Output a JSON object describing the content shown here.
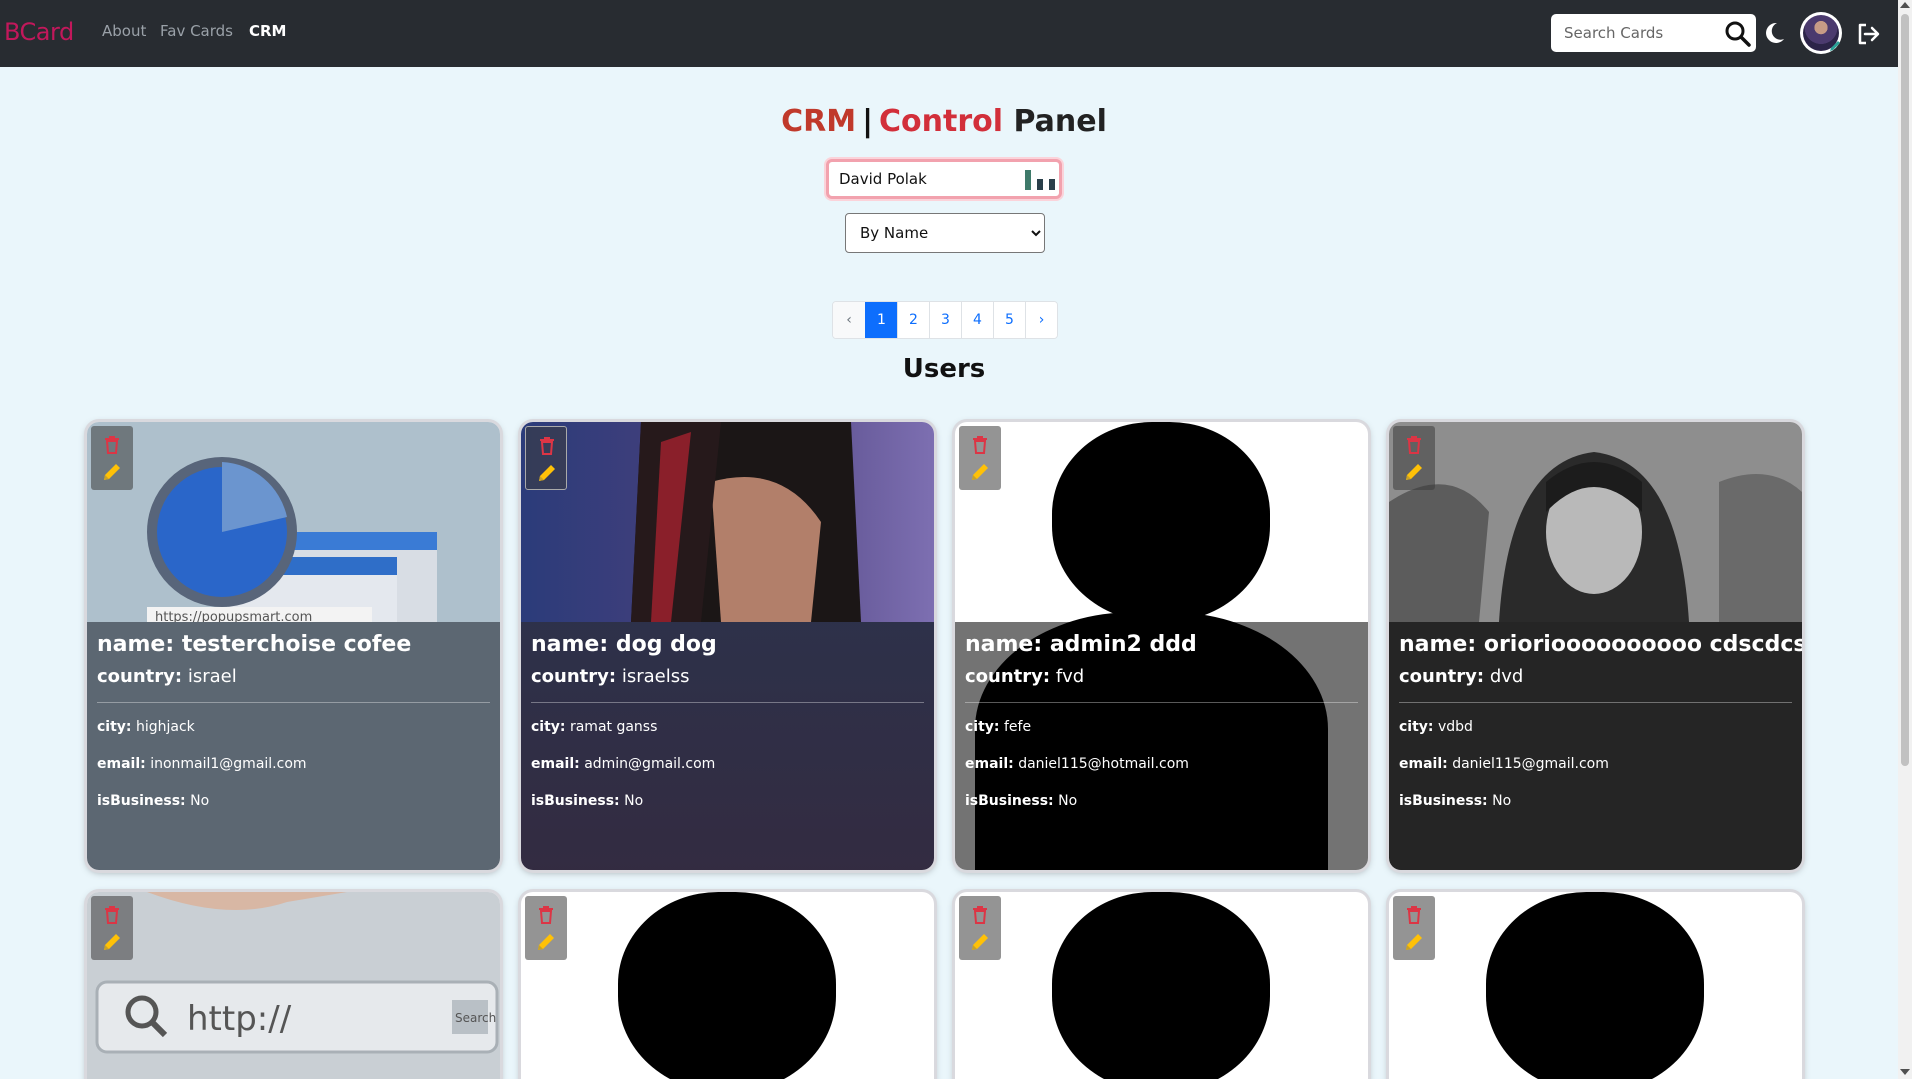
{
  "navbar": {
    "brand": "BCard",
    "links": [
      {
        "label": "About",
        "active": false
      },
      {
        "label": "Fav Cards",
        "active": false
      },
      {
        "label": "CRM",
        "active": true
      }
    ],
    "search_placeholder": "Search Cards",
    "icons": [
      "search-icon",
      "moon-icon",
      "avatar",
      "pencil-icon",
      "logout-icon"
    ]
  },
  "heading": {
    "crm": "CRM",
    "separator": "|",
    "control": "Control",
    "panel": "Panel"
  },
  "crm_search": {
    "value": "David Polak",
    "icon": "bars-icon"
  },
  "filter": {
    "selected": "By Name"
  },
  "pagination": {
    "prev": "‹",
    "next": "›",
    "pages": [
      "1",
      "2",
      "3",
      "4",
      "5"
    ],
    "active_page": "1"
  },
  "section_title": "Users",
  "cards": [
    {
      "name_label": "name:",
      "name": "testerchoise cofee",
      "country_label": "country:",
      "country": "israel",
      "city_label": "city:",
      "city": "highjack",
      "email_label": "email:",
      "email": "inonmail1@gmail.com",
      "business_label": "isBusiness:",
      "business": "No",
      "image": "browser-magnifier-illustration",
      "image_text": "https://popupsmart.com"
    },
    {
      "name_label": "name:",
      "name": "dog dog",
      "country_label": "country:",
      "country": "israelss",
      "city_label": "city:",
      "city": "ramat ganss",
      "email_label": "email:",
      "email": "admin@gmail.com",
      "business_label": "isBusiness:",
      "business": "No",
      "image": "man-portrait-photo"
    },
    {
      "name_label": "name:",
      "name": "admin2 ddd",
      "country_label": "country:",
      "country": "fvd",
      "city_label": "city:",
      "city": "fefe",
      "email_label": "email:",
      "email": "daniel115@hotmail.com",
      "business_label": "isBusiness:",
      "business": "No",
      "image": "default-user-silhouette"
    },
    {
      "name_label": "name:",
      "name": "oriorioooooooooo cdscdcs!",
      "country_label": "country:",
      "country": "dvd",
      "city_label": "city:",
      "city": "vdbd",
      "email_label": "email:",
      "email": "daniel115@gmail.com",
      "business_label": "isBusiness:",
      "business": "No",
      "image": "woman-hood-bw-photo"
    },
    {
      "image": "url-search-bar-photo",
      "image_text": "http://",
      "image_button": "Search"
    },
    {
      "image": "default-user-silhouette"
    },
    {
      "image": "default-user-silhouette"
    },
    {
      "image": "default-user-silhouette"
    }
  ],
  "colors": {
    "navbar_bg": "#282c31",
    "brand": "#c2185b",
    "page_bg": "#eaf6fb",
    "accent_blue": "#0d6efd",
    "delete_red": "#dc3545",
    "edit_yellow": "#ffc107",
    "title_red": "#c0392b"
  }
}
